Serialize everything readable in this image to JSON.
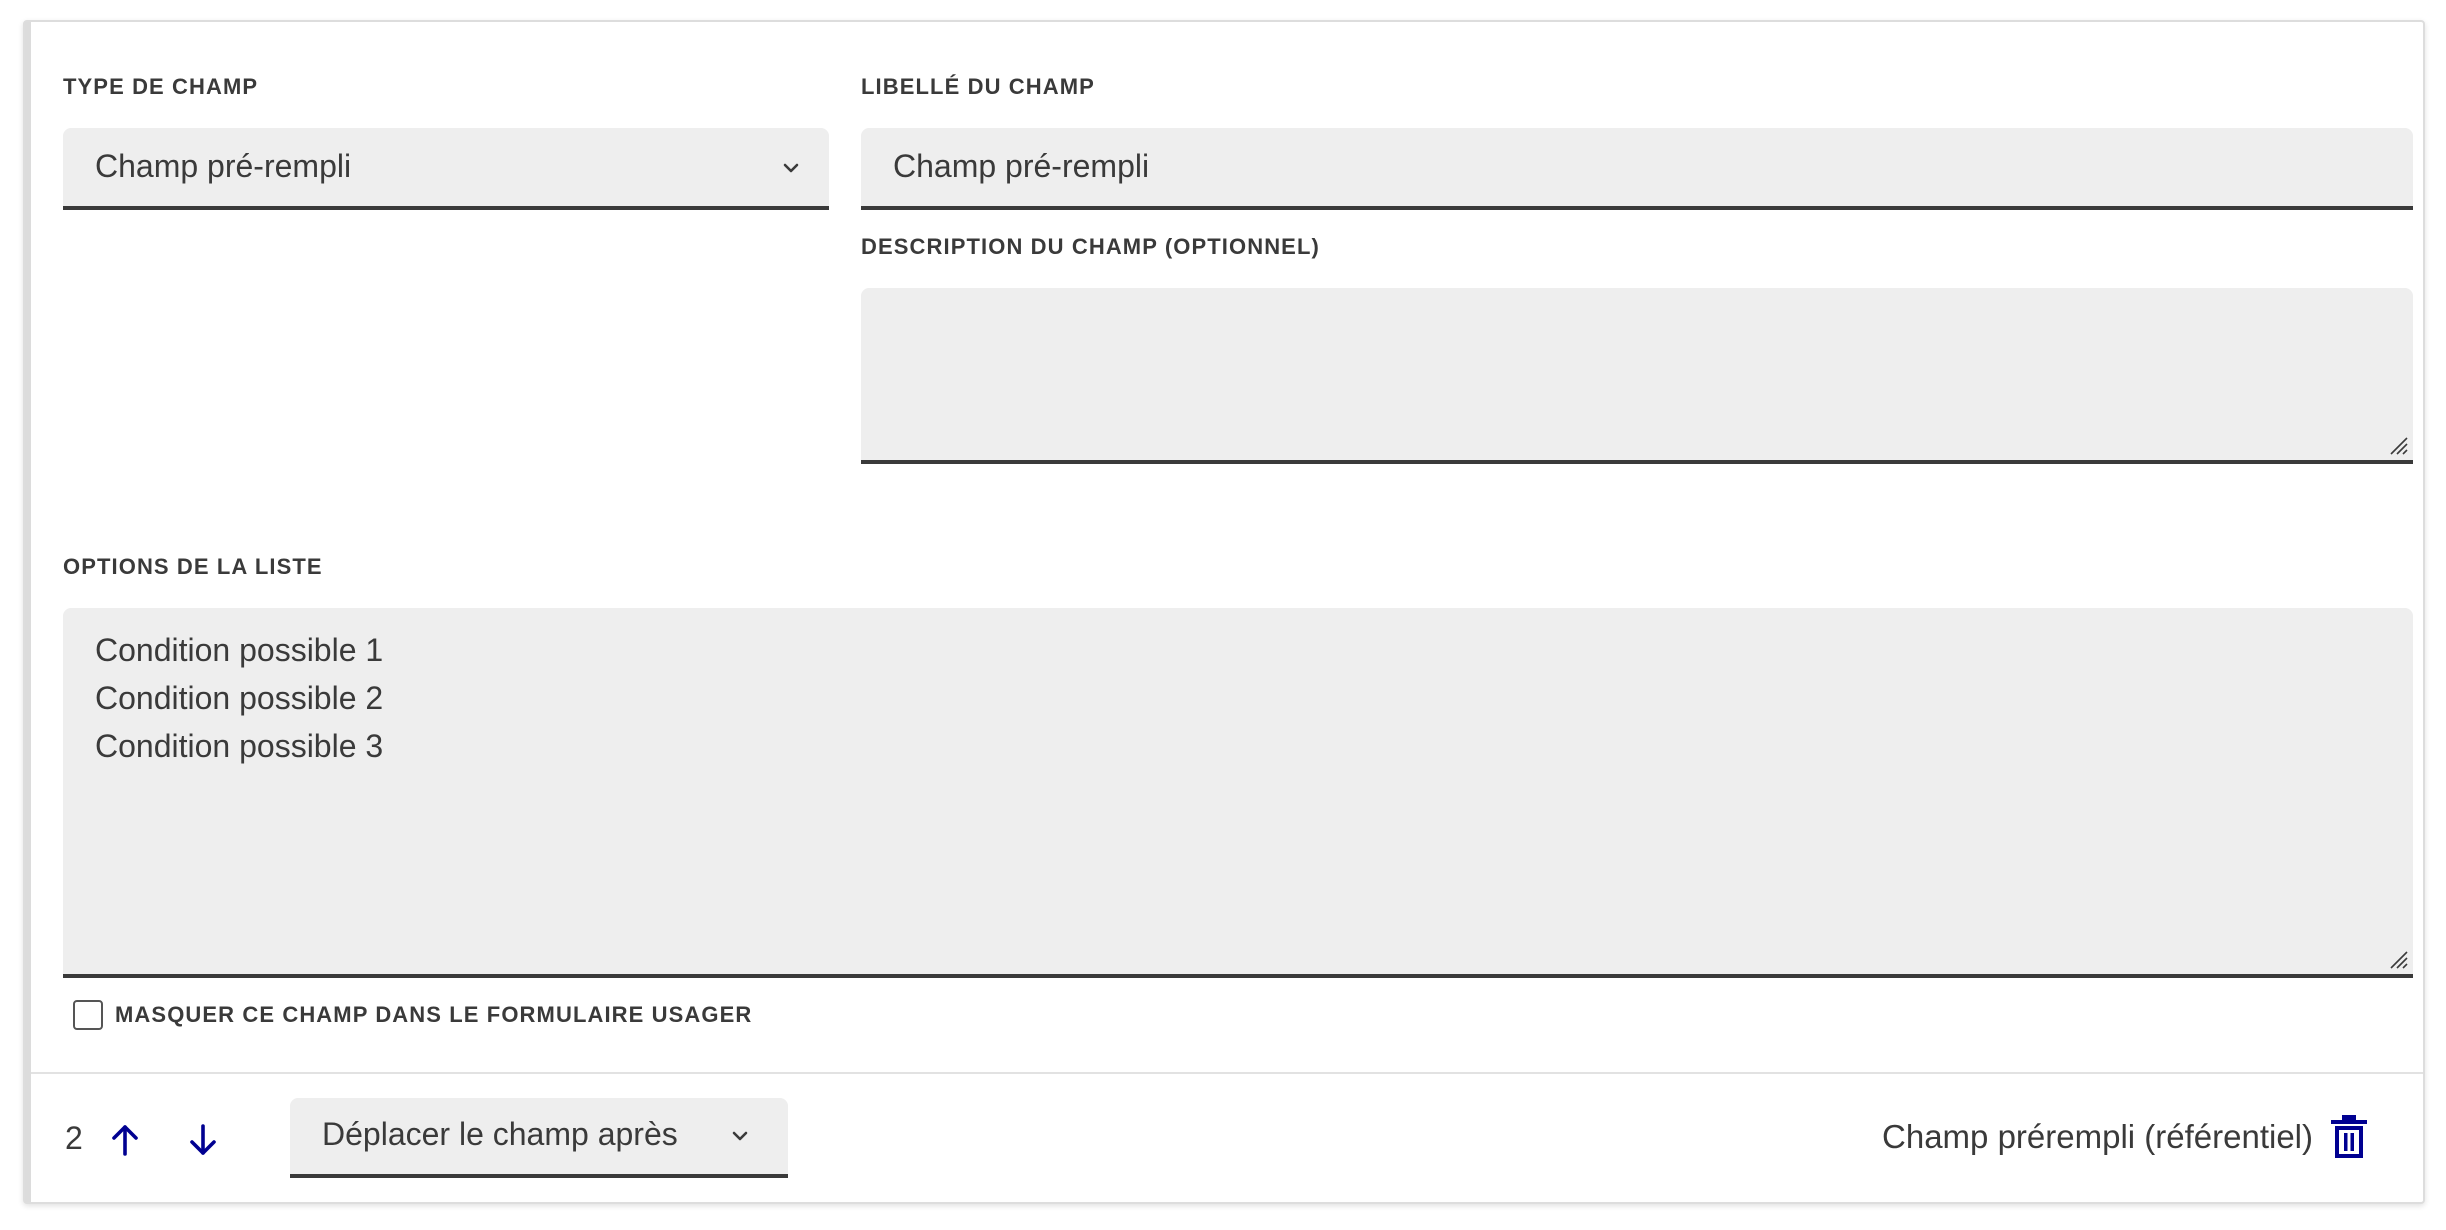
{
  "field_type": {
    "label": "TYPE DE CHAMP",
    "value": "Champ pré-rempli"
  },
  "field_label": {
    "label": "LIBELLÉ DU CHAMP",
    "value": "Champ pré-rempli"
  },
  "field_description": {
    "label": "DESCRIPTION DU CHAMP (OPTIONNEL)",
    "value": ""
  },
  "list_options": {
    "label": "OPTIONS DE LA LISTE",
    "lines": [
      "Condition possible 1",
      "Condition possible 2",
      "Condition possible 3"
    ]
  },
  "hide_field": {
    "label": "MASQUER CE CHAMP DANS LE FORMULAIRE USAGER",
    "checked": false
  },
  "footer": {
    "position": "2",
    "move_after_label": "Déplacer le champ après",
    "type_name": "Champ prérempli (référentiel)"
  },
  "icons": {
    "up": "arrow-up-icon",
    "down": "arrow-down-icon",
    "chevron": "chevron-down-icon",
    "delete": "trash-icon"
  },
  "colors": {
    "accent": "#000091",
    "field_bg": "#eeeeee",
    "text": "#3a3a3a"
  }
}
